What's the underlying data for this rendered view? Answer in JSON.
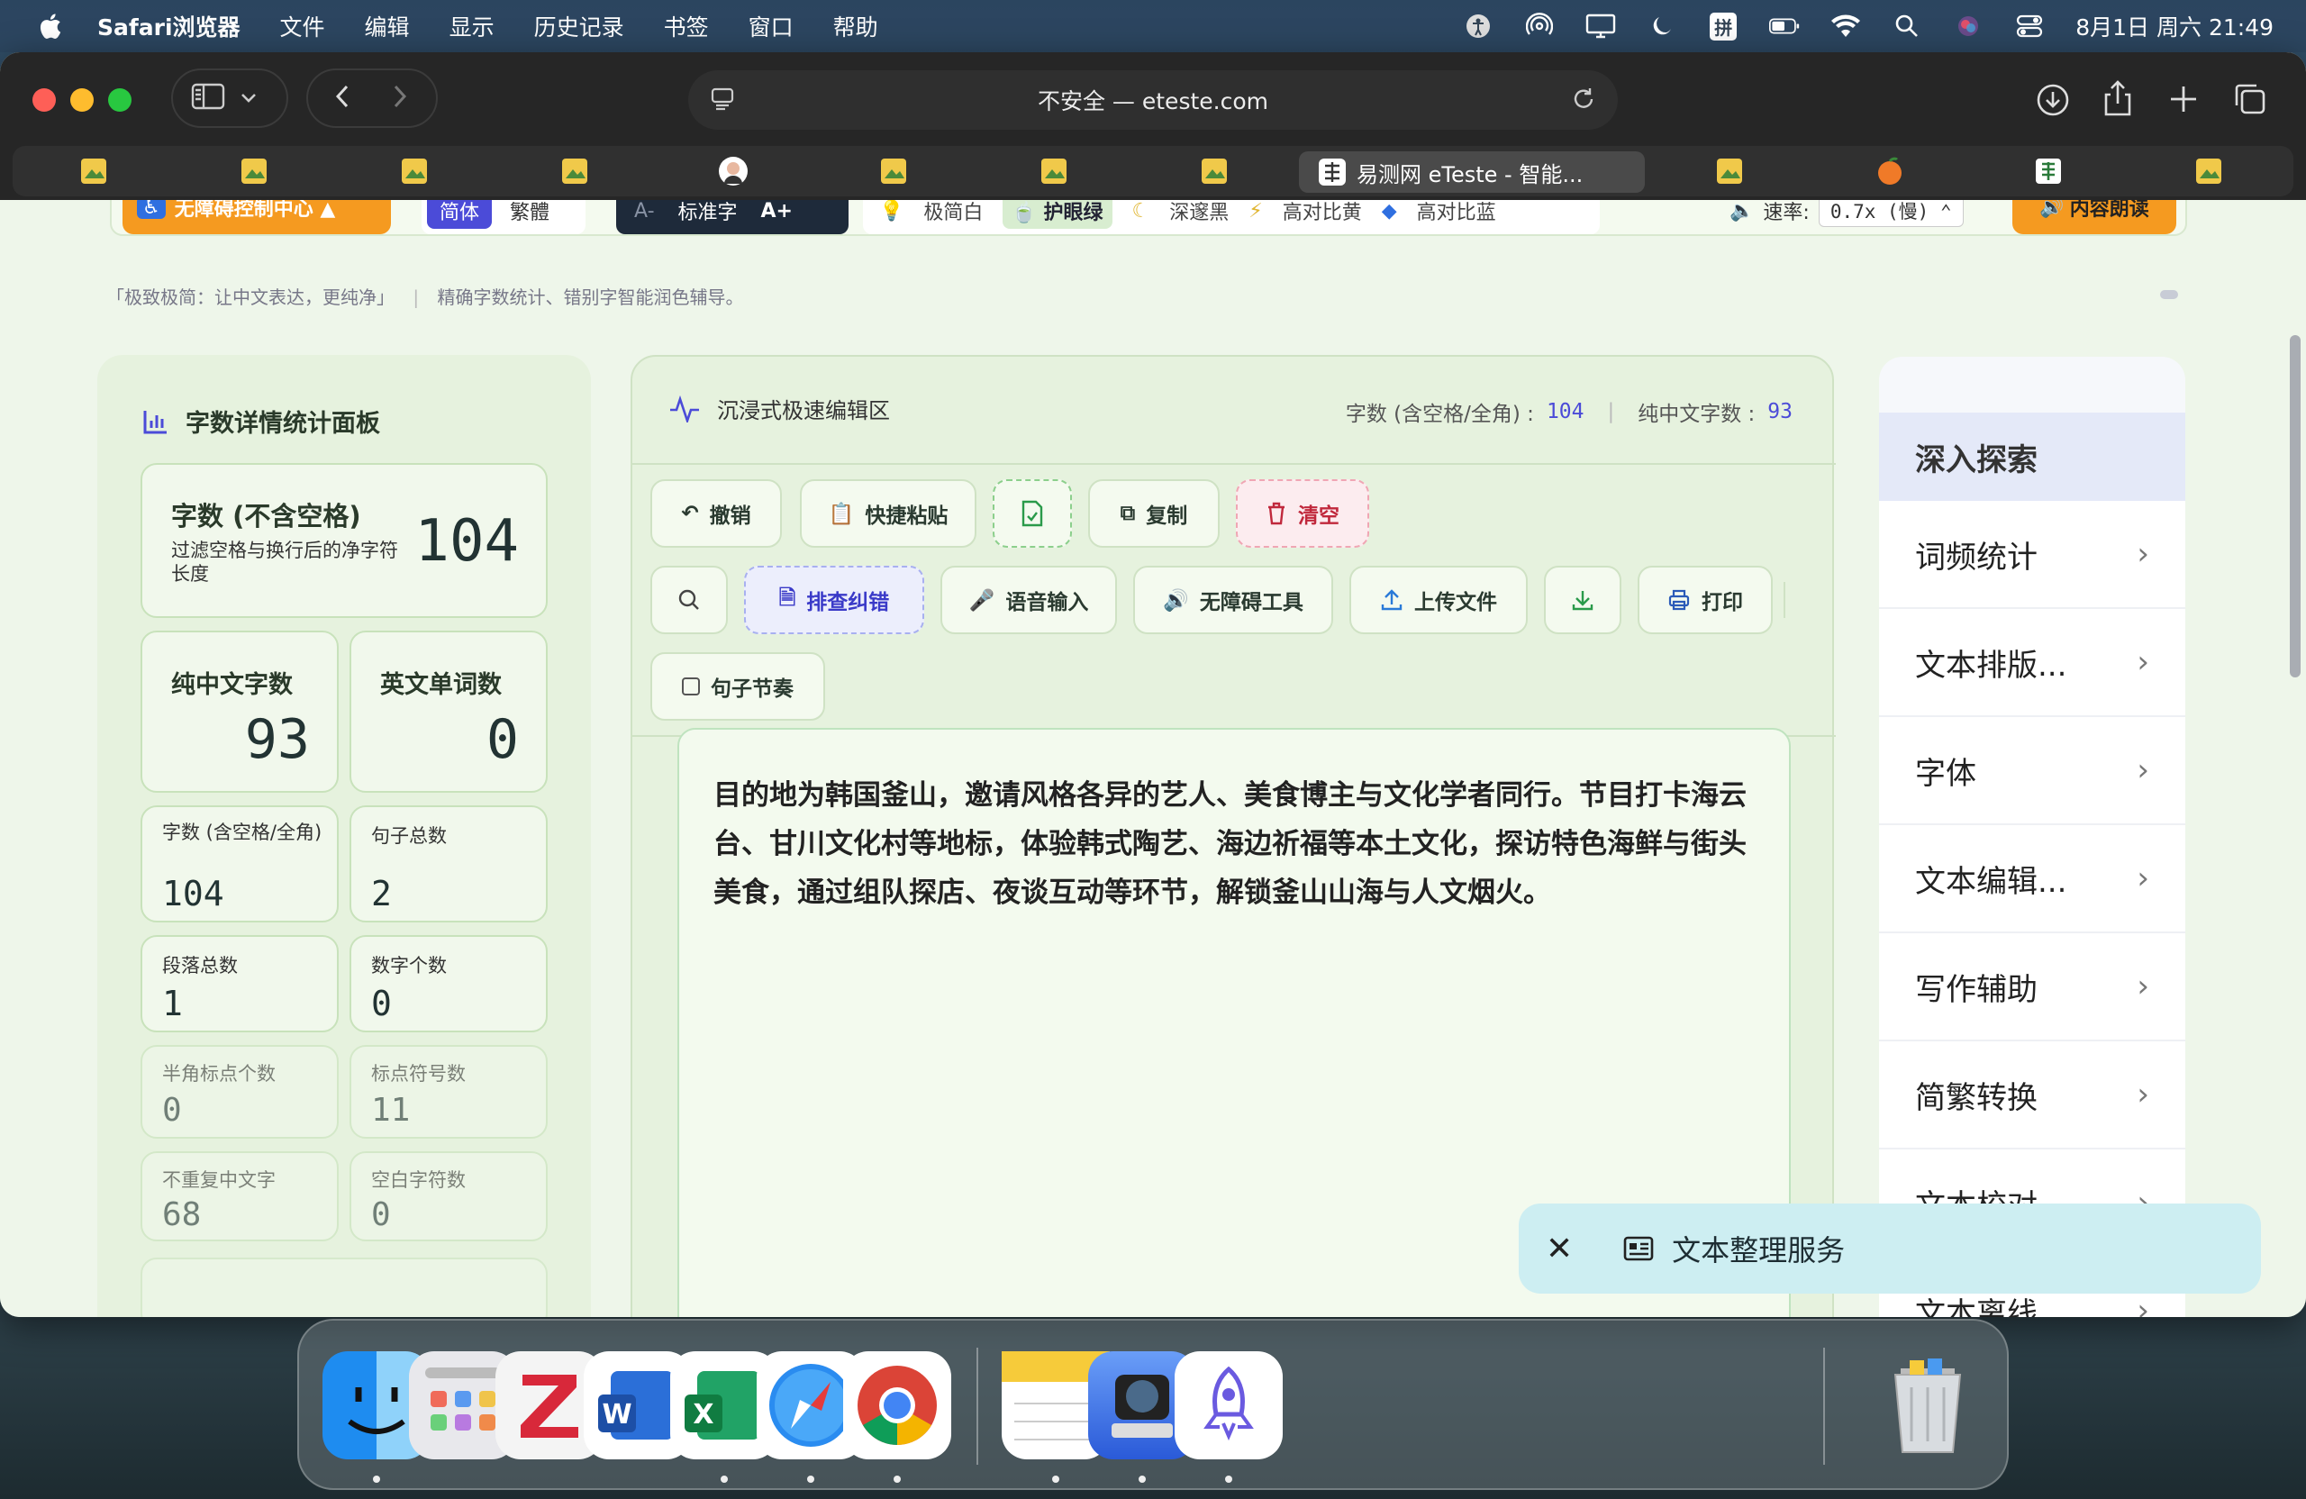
{
  "menubar": {
    "app": "Safari浏览器",
    "items": [
      "文件",
      "编辑",
      "显示",
      "历史记录",
      "书签",
      "窗口",
      "帮助"
    ],
    "input_badge": "拼",
    "clock": "8月1日 周六 21:49"
  },
  "browser": {
    "url": "不安全 — eteste.com",
    "active_tab": "易测网 eTeste - 智能..."
  },
  "a11y": {
    "control_center": "无障碍控制中心 ▲",
    "simplified": "简体",
    "traditional": "繁體",
    "font_smaller": "A-",
    "font_standard": "标准字",
    "font_larger": "A+",
    "themes": [
      "极简白",
      "护眼绿",
      "深邃黑",
      "高对比黄",
      "高对比蓝"
    ],
    "speed_label": "速率:",
    "speed_value": "0.7x (慢)",
    "read_button": "内容朗读"
  },
  "subtitle": {
    "quote": "「极致极简：让中文表达，更纯净」",
    "desc": "精确字数统计、错别字智能润色辅导。"
  },
  "stats": {
    "title": "字数详情统计面板",
    "main_label": "字数 (不含空格)",
    "main_desc": "过滤空格与换行后的净字符长度",
    "main_value": "104",
    "cjk_label": "纯中文字数",
    "cjk_value": "93",
    "eng_label": "英文单词数",
    "eng_value": "0",
    "grid": [
      {
        "label": "字数 (含空格/全角)",
        "value": "104"
      },
      {
        "label": "句子总数",
        "value": "2"
      },
      {
        "label": "段落总数",
        "value": "1"
      },
      {
        "label": "数字个数",
        "value": "0"
      },
      {
        "label": "半角标点个数",
        "value": "0"
      },
      {
        "label": "标点符号数",
        "value": "11"
      },
      {
        "label": "不重复中文字",
        "value": "68"
      },
      {
        "label": "空白字符数",
        "value": "0"
      }
    ]
  },
  "editor": {
    "title": "沉浸式极速编辑区",
    "count_label": "字数 (含空格/全角) :",
    "count_value": "104",
    "cjk_label": "纯中文字数 :",
    "cjk_value": "93",
    "buttons": {
      "undo": "撤销",
      "paste": "快捷粘贴",
      "copy": "复制",
      "clear": "清空",
      "check": "排查纠错",
      "voice": "语音输入",
      "a11y": "无障碍工具",
      "upload": "上传文件",
      "print": "打印",
      "rhythm": "句子节奏"
    },
    "text": "目的地为韩国釜山，邀请风格各异的艺人、美食博主与文化学者同行。节目打卡海云台、甘川文化村等地标，体验韩式陶艺、海边祈福等本土文化，探访特色海鲜与街头美食，通过组队探店、夜谈互动等环节，解锁釜山山海与人文烟火。"
  },
  "sidebar": {
    "title": "深入探索",
    "items": [
      "词频统计",
      "文本排版...",
      "字体",
      "文本编辑...",
      "写作辅助",
      "简繁转换",
      "文本校对",
      "文本离线"
    ]
  },
  "toast": {
    "label": "文本整理服务"
  }
}
